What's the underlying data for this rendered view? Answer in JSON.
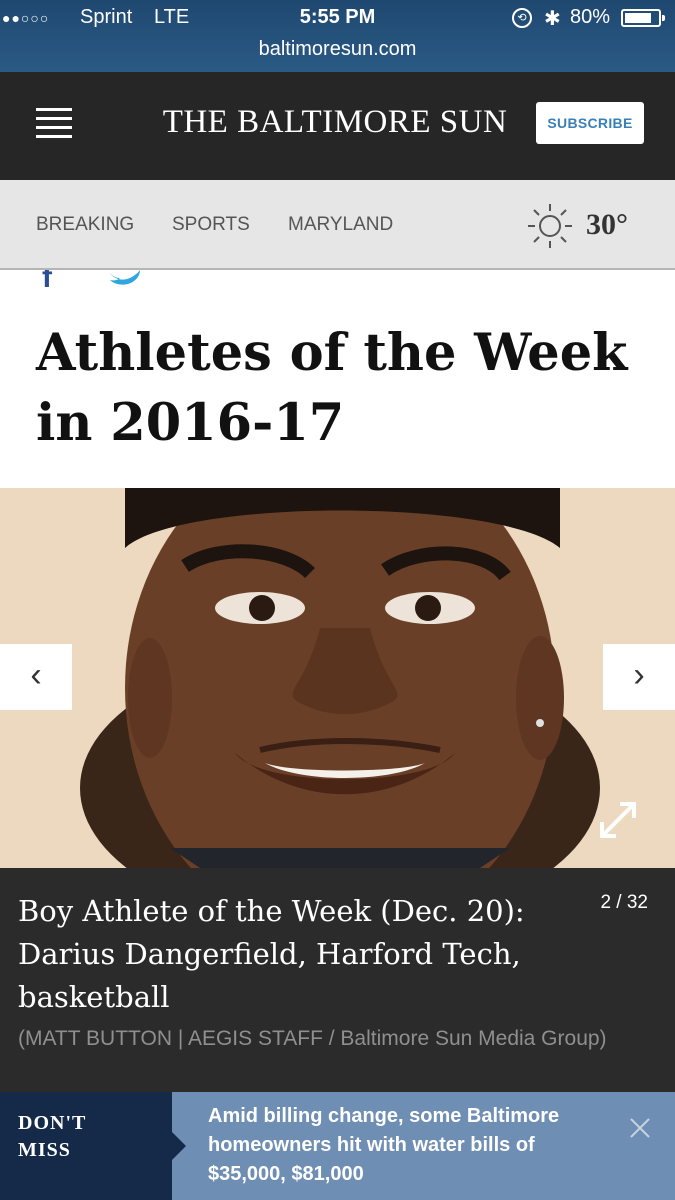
{
  "status_bar": {
    "signal": "●●○○○",
    "carrier": "Sprint",
    "network": "LTE",
    "time": "5:55 PM",
    "battery": "80%",
    "battery_level": 0.8,
    "url": "baltimoresun.com"
  },
  "header": {
    "masthead": "THE BALTIMORE SUN",
    "subscribe_label": "SUBSCRIBE"
  },
  "nav": {
    "items": [
      "BREAKING",
      "SPORTS",
      "MARYLAND"
    ],
    "weather_icon": "sun-icon",
    "temperature": "30°"
  },
  "share": {
    "icons": [
      "facebook-icon",
      "twitter-icon"
    ]
  },
  "gallery": {
    "title": "Athletes of the Week in 2016-17",
    "prev_label": "‹",
    "next_label": "›",
    "counter": "2 / 32",
    "caption": "Boy Athlete of the Week (Dec. 20): Darius Dangerfield, Harford Tech, basketball",
    "credit": "(MATT BUTTON | AEGIS STAFF / Baltimore Sun Media Group)"
  },
  "dont_miss": {
    "label_line1": "DON'T",
    "label_line2": "MISS",
    "headline": "Amid billing change, some Baltimore homeowners hit with water bills of $35,000, $81,000"
  },
  "colors": {
    "header_bg": "#262626",
    "subscribe_text": "#3a80b8",
    "nav_bg": "#e6e6e6",
    "caption_bg": "#2b2b2b",
    "dont_miss_label_bg": "#142a48",
    "dont_miss_story_bg": "#6f8eb3"
  }
}
